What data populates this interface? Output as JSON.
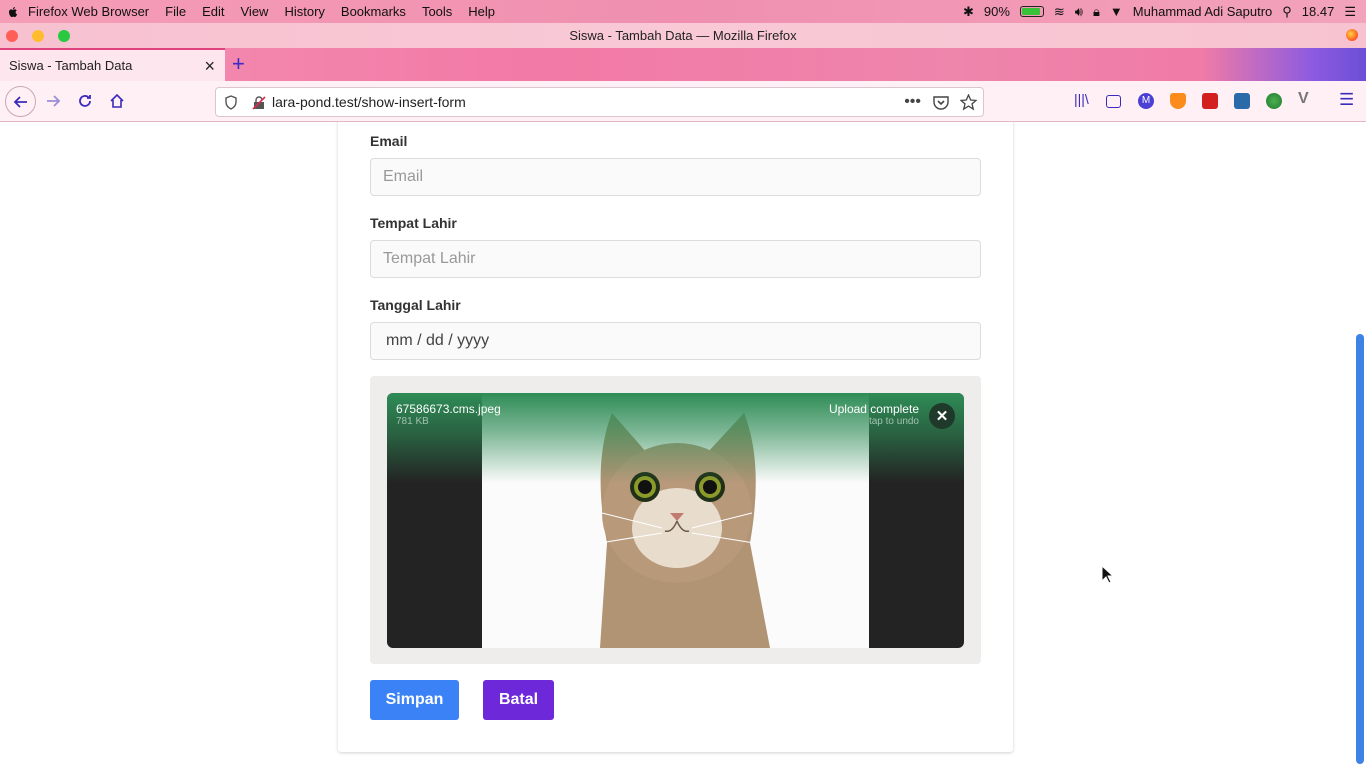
{
  "menubar": {
    "app": "Firefox Web Browser",
    "items": [
      "File",
      "Edit",
      "View",
      "History",
      "Bookmarks",
      "Tools",
      "Help"
    ],
    "battery": "90%",
    "user": "Muhammad Adi Saputro",
    "clock": "18.47",
    "battery_level": 0.9
  },
  "window": {
    "title": "Siswa - Tambah Data — Mozilla Firefox"
  },
  "tab": {
    "title": "Siswa - Tambah Data"
  },
  "url": "lara-pond.test/show-insert-form",
  "form": {
    "email_label": "Email",
    "email_placeholder": "Email",
    "tempat_label": "Tempat Lahir",
    "tempat_placeholder": "Tempat Lahir",
    "tanggal_label": "Tanggal Lahir",
    "tanggal_value": "mm / dd / yyyy"
  },
  "upload": {
    "filename": "67586673.cms.jpeg",
    "filesize": "781 KB",
    "status": "Upload complete",
    "hint": "tap to undo",
    "remove_glyph": "✕",
    "accent": "#369763"
  },
  "buttons": {
    "save": "Simpan",
    "cancel": "Batal",
    "save_color": "#3b82f6",
    "cancel_color": "#6d28d9"
  }
}
